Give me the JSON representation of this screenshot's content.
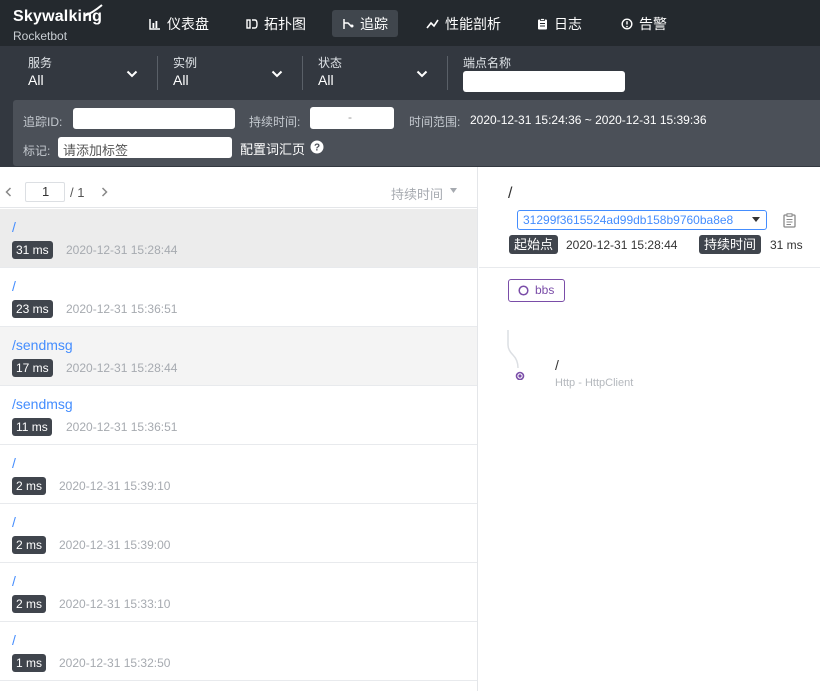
{
  "app": {
    "logo": "Skywalking",
    "sublogo": "Rocketbot"
  },
  "nav": [
    {
      "label": "仪表盘",
      "icon": "dashboard-icon"
    },
    {
      "label": "拓扑图",
      "icon": "topology-icon"
    },
    {
      "label": "追踪",
      "icon": "trace-icon",
      "active": true
    },
    {
      "label": "性能剖析",
      "icon": "profile-icon"
    },
    {
      "label": "日志",
      "icon": "log-icon"
    },
    {
      "label": "告警",
      "icon": "alarm-icon"
    }
  ],
  "filters": {
    "service": {
      "label": "服务",
      "value": "All"
    },
    "instance": {
      "label": "实例",
      "value": "All"
    },
    "status": {
      "label": "状态",
      "value": "All"
    },
    "endpoint": {
      "label": "端点名称",
      "value": ""
    },
    "trace_id_label": "追踪ID:",
    "duration_label": "持续时间:",
    "duration_sep": "-",
    "time_range_label": "时间范围:",
    "time_range_value": "2020-12-31 15:24:36 ~ 2020-12-31 15:39:36",
    "tag_label": "标记:",
    "tag_placeholder": "请添加标签",
    "config_link": "配置词汇页"
  },
  "pager": {
    "current": "1",
    "total": "/ 1",
    "sort_label": "持续时间"
  },
  "traces": [
    {
      "path": "/",
      "duration": "31 ms",
      "time": "2020-12-31 15:28:44",
      "selected": true
    },
    {
      "path": "/",
      "duration": "23 ms",
      "time": "2020-12-31 15:36:51"
    },
    {
      "path": "/sendmsg",
      "duration": "17 ms",
      "time": "2020-12-31 15:28:44",
      "hover": true
    },
    {
      "path": "/sendmsg",
      "duration": "11 ms",
      "time": "2020-12-31 15:36:51"
    },
    {
      "path": "/",
      "duration": "2 ms",
      "time": "2020-12-31 15:39:10"
    },
    {
      "path": "/",
      "duration": "2 ms",
      "time": "2020-12-31 15:39:00"
    },
    {
      "path": "/",
      "duration": "2 ms",
      "time": "2020-12-31 15:33:10"
    },
    {
      "path": "/",
      "duration": "1 ms",
      "time": "2020-12-31 15:32:50"
    }
  ],
  "detail": {
    "title": "/",
    "trace_id": "31299f3615524ad99db158b9760ba8e8",
    "start_label": "起始点",
    "start_value": "2020-12-31 15:28:44",
    "duration_label": "持续时间",
    "duration_value": "31 ms",
    "service_tag": "bbs",
    "span": {
      "name": "/",
      "component": "Http - HttpClient"
    }
  },
  "colors": {
    "topbar": "#24292e",
    "filterbar": "#333840",
    "link": "#448dfe",
    "accent": "#7a4da8"
  }
}
